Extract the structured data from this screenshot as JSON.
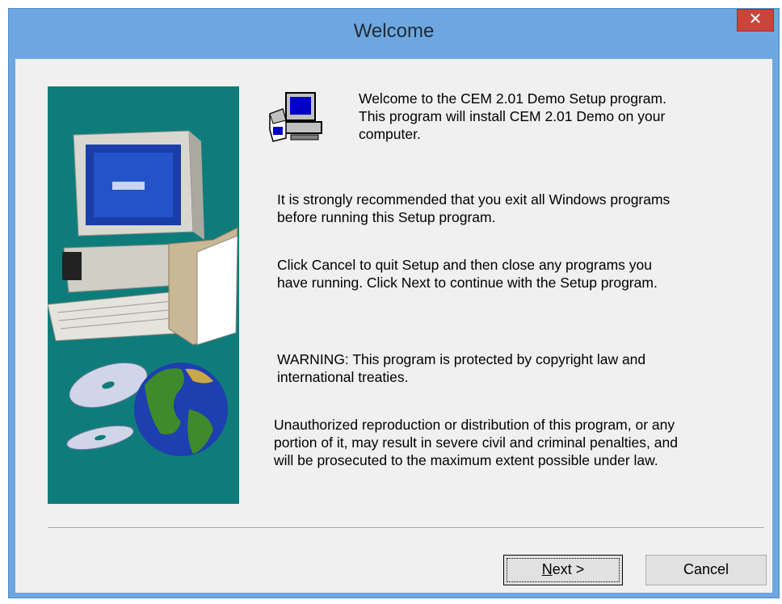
{
  "window": {
    "title": "Welcome",
    "close_glyph": "✕"
  },
  "content": {
    "intro_lines": [
      "Welcome to the CEM 2.01 Demo Setup program.",
      "This program will install CEM 2.01 Demo on your",
      "computer."
    ],
    "recommend_lines": [
      "It is strongly recommended that you exit all Windows programs",
      "before running this Setup program."
    ],
    "cancel_lines": [
      "Click Cancel to quit Setup and then close any programs you",
      "have running.  Click Next to continue with the Setup program."
    ],
    "warning_lines": [
      "WARNING: This program is protected by copyright law and",
      "international treaties."
    ],
    "unauthorized_lines": [
      "Unauthorized reproduction or distribution of this program, or any",
      "portion of it, may result in severe civil and criminal penalties, and",
      "will be prosecuted to the maximum extent possible under law."
    ]
  },
  "buttons": {
    "next_mnemonic": "N",
    "next_rest": "ext >",
    "cancel": "Cancel"
  },
  "icons": {
    "setup": "setup-computer-icon",
    "side": "computer-globe-cd-illustration",
    "close": "close-icon"
  },
  "colors": {
    "titlebar": "#6ea7e0",
    "close": "#c7453b",
    "side_panel": "#0f7c7c",
    "dialog_bg": "#f0f0f0"
  }
}
